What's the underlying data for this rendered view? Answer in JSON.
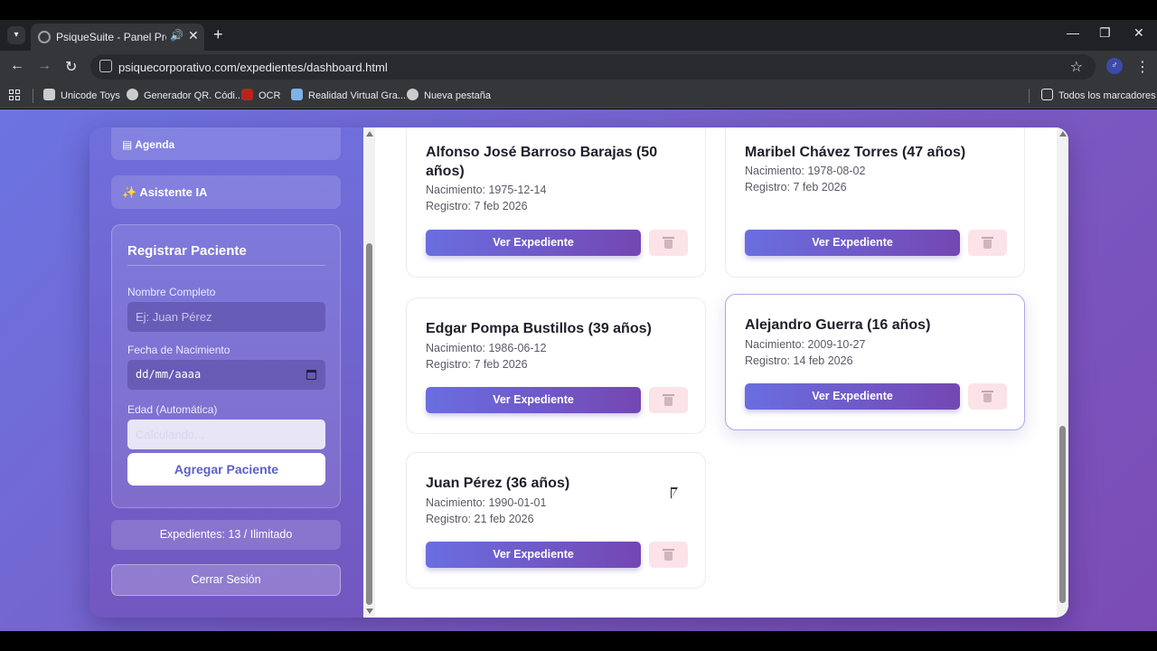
{
  "browser": {
    "tab_title": "PsiqueSuite - Panel Profesional",
    "url": "psiquecorporativo.com/expedientes/dashboard.html",
    "bookmarks": [
      "Unicode Toys",
      "Generador QR. Códi...",
      "OCR",
      "Realidad Virtual Gra...",
      "Nueva pestaña"
    ],
    "all_bookmarks": "Todos los marcadores"
  },
  "sidebar": {
    "agenda": "▤ Agenda",
    "assistant": "✨ Asistente IA",
    "form": {
      "title": "Registrar Paciente",
      "name_label": "Nombre Completo",
      "name_placeholder": "Ej: Juan Pérez",
      "dob_label": "Fecha de Nacimiento",
      "dob_placeholder": "dd/mm/aaaa",
      "age_label": "Edad (Automática)",
      "age_placeholder": "Calculando...",
      "add_button": "Agregar Paciente"
    },
    "count": "Expedientes: 13 / Ilimitado",
    "logout": "Cerrar Sesión"
  },
  "patients": [
    {
      "name": "Alfonso José Barroso Barajas (50 años)",
      "birth": "Nacimiento: 1975-12-14",
      "registered": "Registro: 7 feb 2026",
      "view": "Ver Expediente"
    },
    {
      "name": "Maribel Chávez Torres (47 años)",
      "birth": "Nacimiento: 1978-08-02",
      "registered": "Registro: 7 feb 2026",
      "view": "Ver Expediente"
    },
    {
      "name": "Edgar Pompa Bustillos (39 años)",
      "birth": "Nacimiento: 1986-06-12",
      "registered": "Registro: 7 feb 2026",
      "view": "Ver Expediente"
    },
    {
      "name": "Alejandro Guerra (16 años)",
      "birth": "Nacimiento: 2009-10-27",
      "registered": "Registro: 14 feb 2026",
      "view": "Ver Expediente"
    },
    {
      "name": "Juan Pérez (36 años)",
      "birth": "Nacimiento: 1990-01-01",
      "registered": "Registro: 21 feb 2026",
      "view": "Ver Expediente"
    }
  ],
  "colors": {
    "accent": "#6a6ee0",
    "accent_dark": "#7447b2",
    "delete_bg": "#fbe3e8"
  }
}
